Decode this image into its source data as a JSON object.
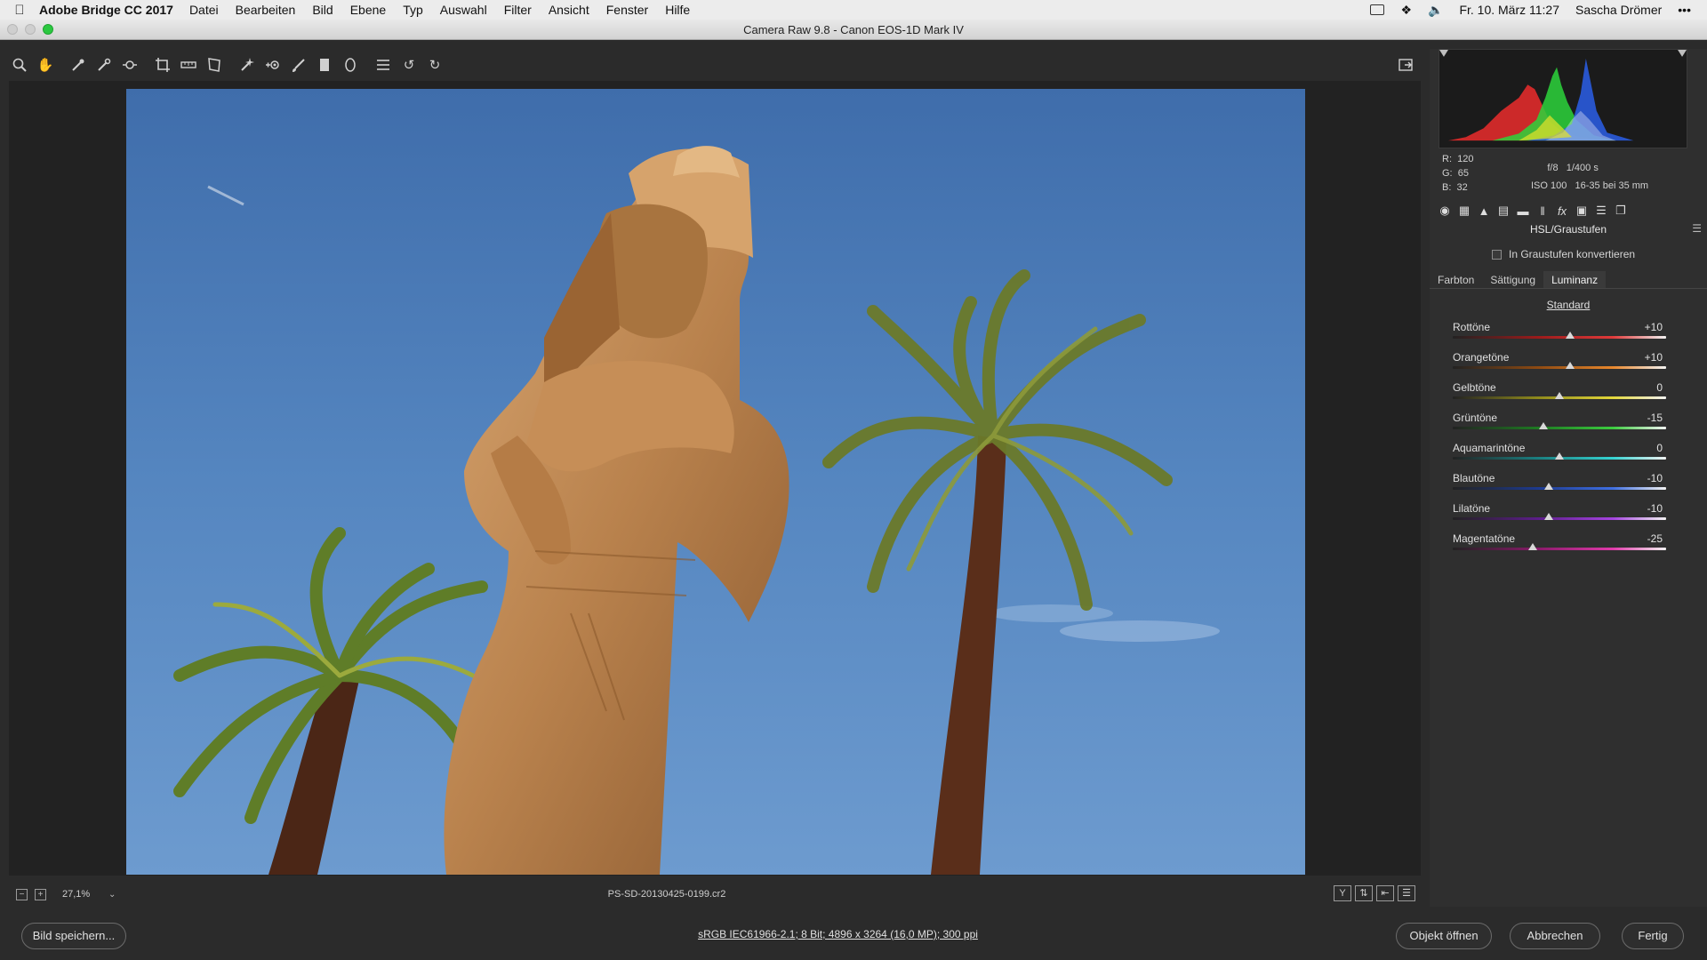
{
  "menubar": {
    "app_name": "Adobe Bridge CC 2017",
    "menus": [
      "Datei",
      "Bearbeiten",
      "Bild",
      "Ebene",
      "Typ",
      "Auswahl",
      "Filter",
      "Ansicht",
      "Fenster",
      "Hilfe"
    ],
    "datetime": "Fr. 10. März  11:27",
    "user": "Sascha Drömer",
    "more": "•••"
  },
  "window": {
    "title": "Camera Raw 9.8  -  Canon EOS-1D Mark IV"
  },
  "info": {
    "r_label": "R:",
    "r_value": "120",
    "g_label": "G:",
    "g_value": "65",
    "b_label": "B:",
    "b_value": "32",
    "aperture": "f/8",
    "shutter": "1/400 s",
    "iso": "ISO 100",
    "lens": "16-35 bei 35 mm"
  },
  "panel": {
    "title": "HSL/Graustufen",
    "convert_label": "In Graustufen konvertieren",
    "tabs": [
      "Farbton",
      "Sättigung",
      "Luminanz"
    ],
    "active_tab": 2,
    "standard_link": "Standard",
    "sliders": [
      {
        "label": "Rottöne",
        "value": "+10",
        "num": 10,
        "colors": [
          "#9b1b1b",
          "#e03a3a"
        ]
      },
      {
        "label": "Orangetöne",
        "value": "+10",
        "num": 10,
        "colors": [
          "#8e4a12",
          "#e8872c"
        ]
      },
      {
        "label": "Gelbtöne",
        "value": "0",
        "num": 0,
        "colors": [
          "#8f8a1c",
          "#e3d73a"
        ]
      },
      {
        "label": "Grüntöne",
        "value": "-15",
        "num": -15,
        "colors": [
          "#1e7a22",
          "#3ccc3f"
        ]
      },
      {
        "label": "Aquamarintöne",
        "value": "0",
        "num": 0,
        "colors": [
          "#1a7f80",
          "#35d3d1"
        ]
      },
      {
        "label": "Blautöne",
        "value": "-10",
        "num": -10,
        "colors": [
          "#1d3a8f",
          "#3f6fe2"
        ]
      },
      {
        "label": "Lilatöne",
        "value": "-10",
        "num": -10,
        "colors": [
          "#5c1d8a",
          "#a544e0"
        ]
      },
      {
        "label": "Magentatöne",
        "value": "-25",
        "num": -25,
        "colors": [
          "#8a1a6a",
          "#e03aaa"
        ]
      }
    ]
  },
  "status": {
    "zoom": "27,1%",
    "filename": "PS-SD-20130425-0199.cr2"
  },
  "footer": {
    "save_label": "Bild speichern...",
    "workflow": "sRGB IEC61966-2.1; 8 Bit; 4896 x 3264 (16,0 MP); 300 ppi",
    "open_label": "Objekt öffnen",
    "cancel_label": "Abbrechen",
    "done_label": "Fertig"
  },
  "colors": {
    "accent": "#2bc840",
    "panel_bg": "#2f2f2f",
    "canvas_bg": "#222222"
  }
}
